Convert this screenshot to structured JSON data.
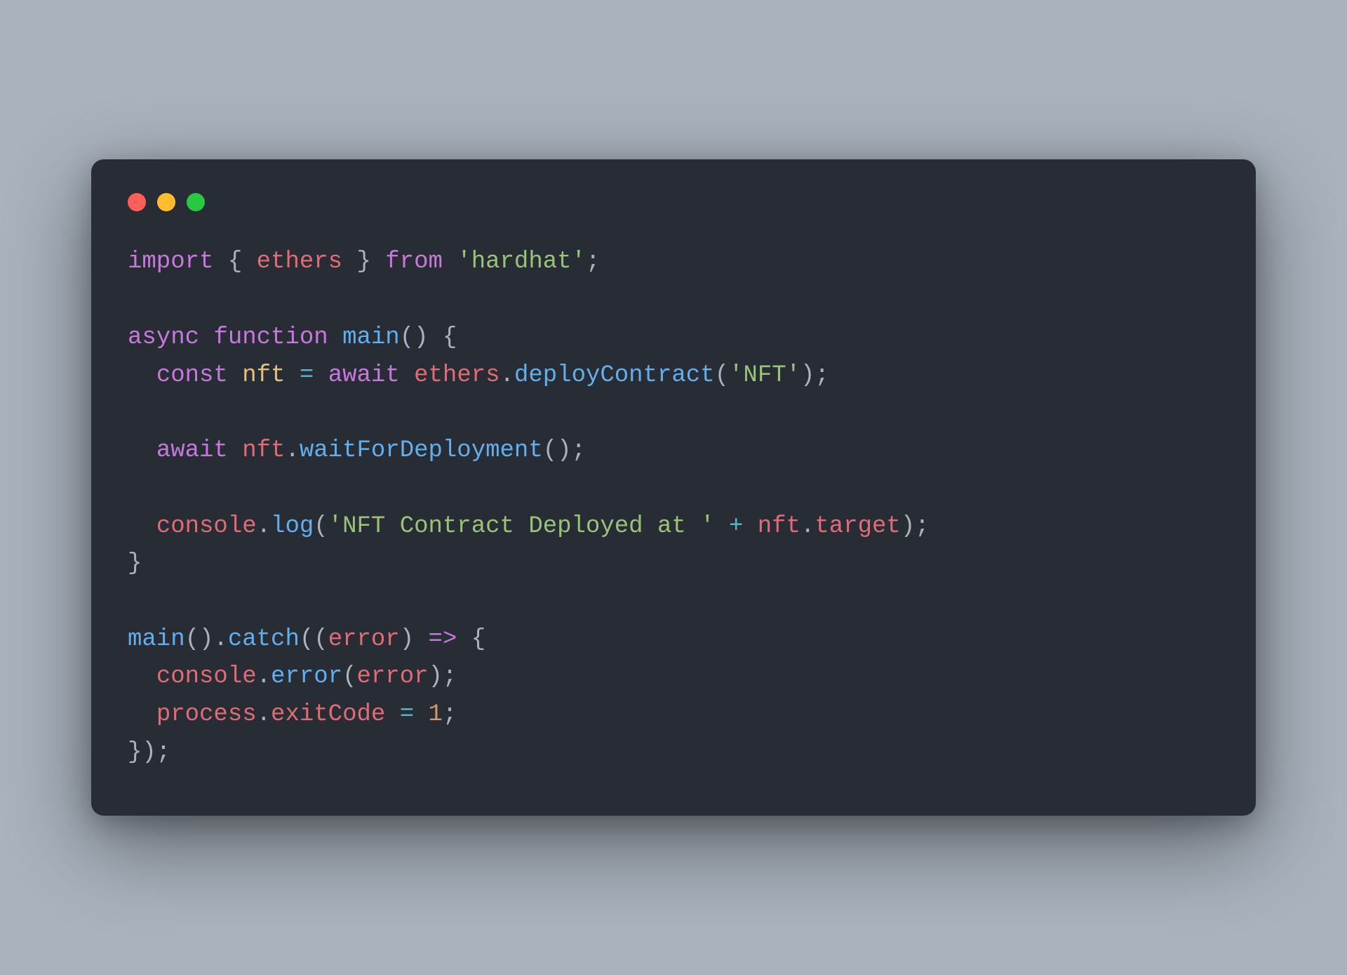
{
  "code": {
    "line1": {
      "import": "import",
      "brace_open": " { ",
      "ethers": "ethers",
      "brace_close": " } ",
      "from": "from",
      "space": " ",
      "str": "'hardhat'",
      "semi": ";"
    },
    "line3": {
      "async": "async",
      "space1": " ",
      "function": "function",
      "space2": " ",
      "main": "main",
      "parens": "()",
      "space3": " ",
      "brace": "{"
    },
    "line4": {
      "indent": "  ",
      "const": "const",
      "space1": " ",
      "nft": "nft",
      "space2": " ",
      "eq": "=",
      "space3": " ",
      "await": "await",
      "space4": " ",
      "ethers": "ethers",
      "dot": ".",
      "deploy": "deployContract",
      "paren_open": "(",
      "str": "'NFT'",
      "paren_close": ")",
      "semi": ";"
    },
    "line6": {
      "indent": "  ",
      "await": "await",
      "space": " ",
      "nft": "nft",
      "dot": ".",
      "wait": "waitForDeployment",
      "parens": "()",
      "semi": ";"
    },
    "line8": {
      "indent": "  ",
      "console": "console",
      "dot1": ".",
      "log": "log",
      "paren_open": "(",
      "str": "'NFT Contract Deployed at '",
      "space1": " ",
      "plus": "+",
      "space2": " ",
      "nft": "nft",
      "dot2": ".",
      "target": "target",
      "paren_close": ")",
      "semi": ";"
    },
    "line9": {
      "brace": "}"
    },
    "line11": {
      "main": "main",
      "parens1": "()",
      "dot": ".",
      "catch": "catch",
      "paren_open": "(",
      "paren_inner_open": "(",
      "error": "error",
      "paren_inner_close": ")",
      "space1": " ",
      "arrow": "=>",
      "space2": " ",
      "brace": "{"
    },
    "line12": {
      "indent": "  ",
      "console": "console",
      "dot": ".",
      "errorfn": "error",
      "paren_open": "(",
      "error": "error",
      "paren_close": ")",
      "semi": ";"
    },
    "line13": {
      "indent": "  ",
      "process": "process",
      "dot": ".",
      "exitCode": "exitCode",
      "space1": " ",
      "eq": "=",
      "space2": " ",
      "num": "1",
      "semi": ";"
    },
    "line14": {
      "close": "});"
    }
  },
  "traffic": {
    "red": "#ff5f56",
    "yellow": "#ffbd2e",
    "green": "#27c93f"
  },
  "theme": {
    "bg": "#282c34",
    "page_bg": "#a9b2bd"
  }
}
